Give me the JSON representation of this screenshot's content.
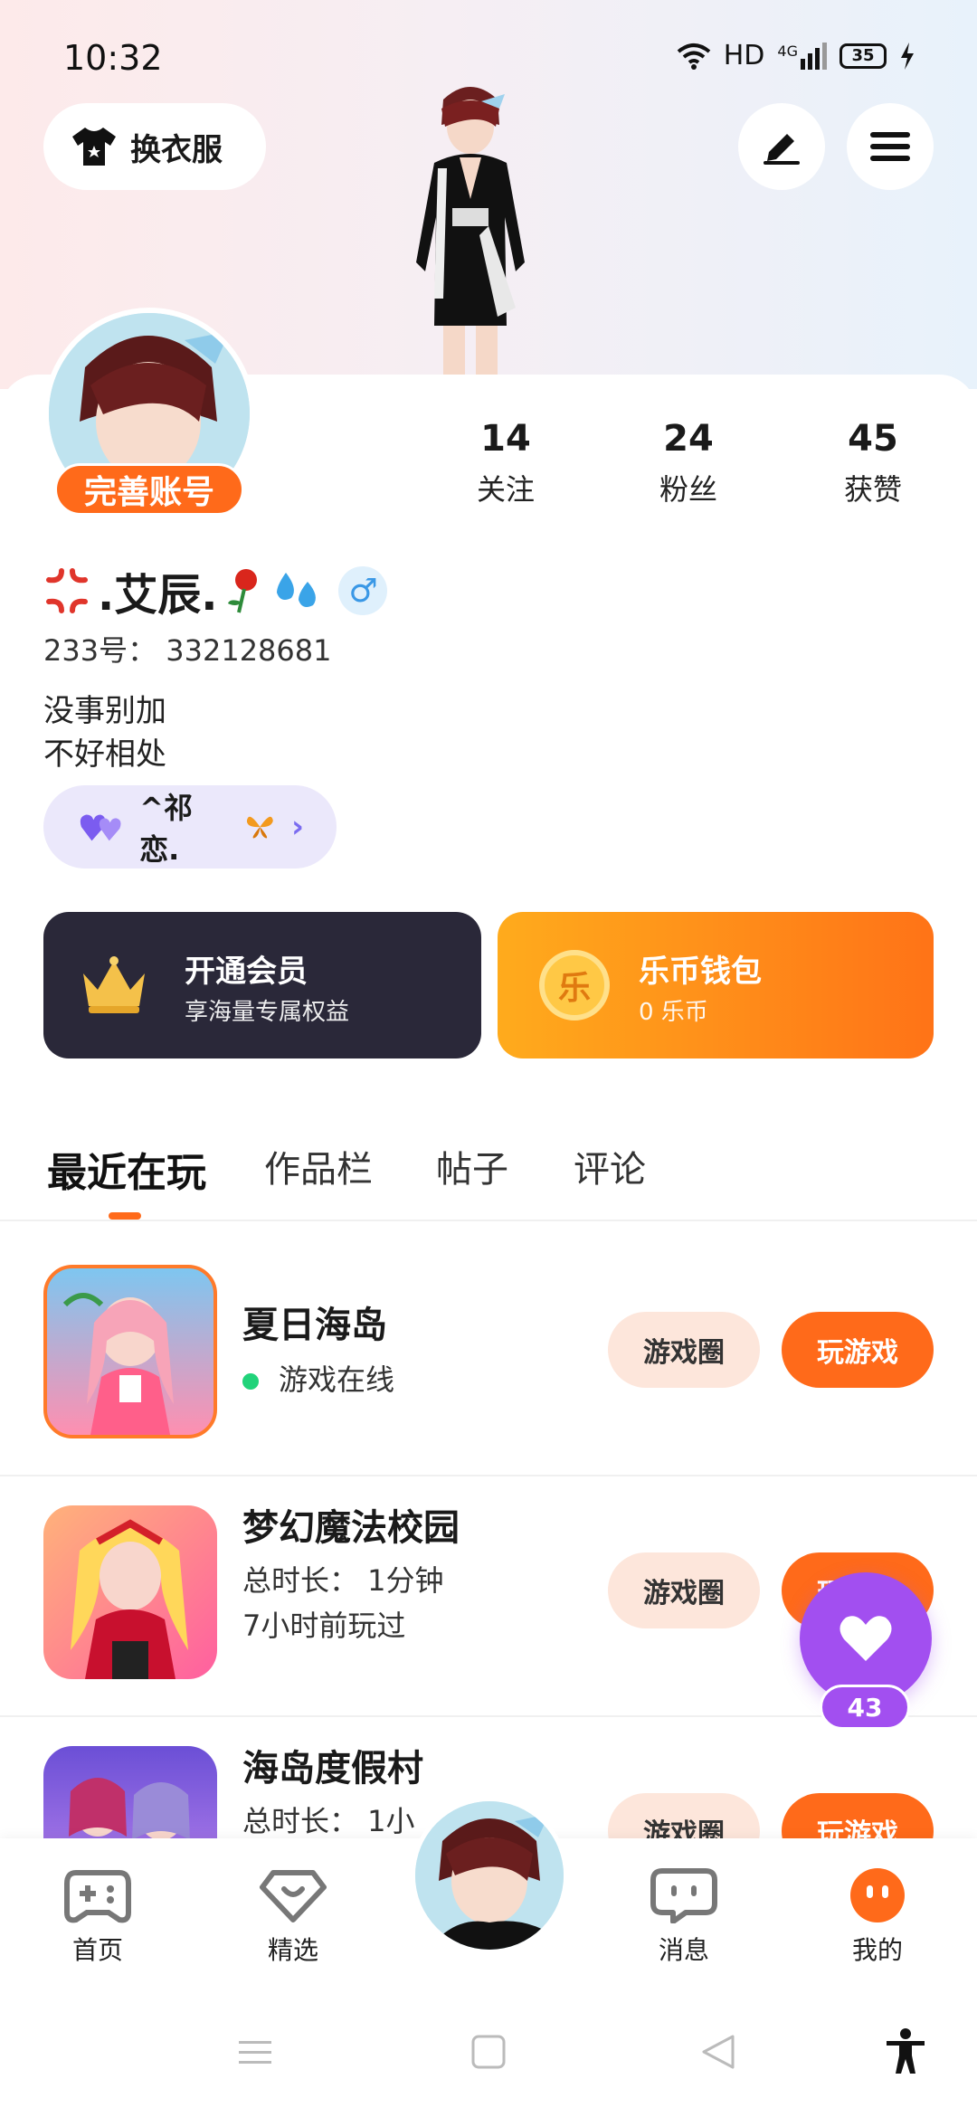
{
  "status_bar": {
    "time": "10:32",
    "network": "HD",
    "signal": "4G",
    "battery": "35"
  },
  "header": {
    "outfit_label": "换衣服"
  },
  "profile": {
    "complete_label": "完善账号",
    "stats": [
      {
        "value": "14",
        "label": "关注"
      },
      {
        "value": "24",
        "label": "粉丝"
      },
      {
        "value": "45",
        "label": "获赞"
      }
    ],
    "nickname_text": ".艾辰.",
    "gender_symbol": "♂",
    "uid": "233号： 332128681",
    "bio_line1": "没事别加",
    "bio_line2": "不好相处",
    "cp_name": "^祁恋."
  },
  "cards": {
    "vip": {
      "title": "开通会员",
      "subtitle": "享海量专属权益"
    },
    "wallet": {
      "title": "乐币钱包",
      "subtitle": "0 乐币",
      "coin_char": "乐"
    }
  },
  "tabs": [
    {
      "label": "最近在玩"
    },
    {
      "label": "作品栏"
    },
    {
      "label": "帖子"
    },
    {
      "label": "评论"
    }
  ],
  "games": [
    {
      "name": "夏日海岛",
      "line1": "游戏在线",
      "line2": "",
      "circle_label": "游戏圈",
      "play_label": "玩游戏"
    },
    {
      "name": "梦幻魔法校园",
      "line1": "总时长： 1分钟",
      "line2": "7小时前玩过",
      "circle_label": "游戏圈",
      "play_label": "玩游戏"
    },
    {
      "name": "海岛度假村",
      "line1": "总时长： 1小",
      "line2": "",
      "circle_label": "游戏圈",
      "play_label": "玩游戏"
    }
  ],
  "like_float": {
    "count": "43"
  },
  "bottom_nav": [
    {
      "label": "首页"
    },
    {
      "label": "精选"
    },
    {
      "label": "消息"
    },
    {
      "label": "我的"
    }
  ],
  "colors": {
    "accent": "#ff6a1a",
    "vip_bg": "#2a2839",
    "like": "#a24ff0",
    "online": "#21d37a"
  }
}
